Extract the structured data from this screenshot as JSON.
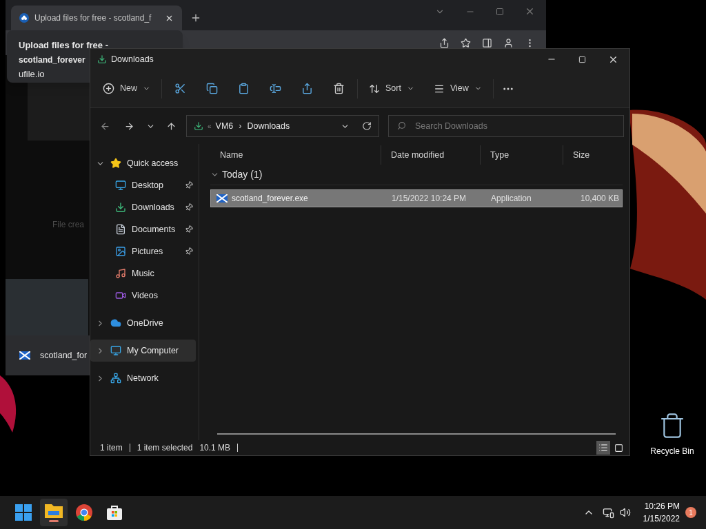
{
  "browser": {
    "tab": {
      "title": "Upload files for free - scotland_f",
      "selected": true
    },
    "tooltip": {
      "title": "Upload files for free -",
      "subtitle": "scotland_forever",
      "url": "ufile.io"
    },
    "page_text": "File crea",
    "download_item": {
      "name": "scotland_for"
    }
  },
  "explorer": {
    "title": "Downloads",
    "toolbar": {
      "new": "New",
      "sort": "Sort",
      "view": "View"
    },
    "address": {
      "overflow": "«",
      "parts": [
        "VM6",
        "Downloads"
      ],
      "separator": "›"
    },
    "search": {
      "placeholder": "Search Downloads"
    },
    "sidebar": [
      {
        "label": "Quick access",
        "kind": "star",
        "expanded": true,
        "selected": false,
        "children": [
          {
            "label": "Desktop",
            "kind": "desktop",
            "pinned": true,
            "selected": false
          },
          {
            "label": "Downloads",
            "kind": "download",
            "pinned": true,
            "selected": false
          },
          {
            "label": "Documents",
            "kind": "document",
            "pinned": true,
            "selected": false
          },
          {
            "label": "Pictures",
            "kind": "picture",
            "pinned": true,
            "selected": false
          },
          {
            "label": "Music",
            "kind": "music",
            "pinned": false,
            "selected": false
          },
          {
            "label": "Videos",
            "kind": "video",
            "pinned": false,
            "selected": false
          }
        ]
      },
      {
        "label": "OneDrive",
        "kind": "cloud",
        "expanded": false,
        "selected": false
      },
      {
        "label": "My Computer",
        "kind": "computer",
        "expanded": false,
        "selected": true
      },
      {
        "label": "Network",
        "kind": "network",
        "expanded": false,
        "selected": false
      }
    ],
    "columns": [
      "Name",
      "Date modified",
      "Type",
      "Size"
    ],
    "groups": [
      {
        "label": "Today (1)",
        "expanded": true,
        "rows": [
          {
            "name": "scotland_forever.exe",
            "date": "1/15/2022 10:24 PM",
            "type": "Application",
            "size": "10,400 KB",
            "selected": true
          }
        ]
      }
    ],
    "status": {
      "count": "1 item",
      "selection": "1 item selected",
      "size": "10.1 MB"
    },
    "view_modes": [
      {
        "kind": "details",
        "selected": true
      },
      {
        "kind": "tiles",
        "selected": false
      }
    ]
  },
  "desktop": {
    "icons": [
      {
        "label": "Recycle Bin"
      }
    ]
  },
  "taskbar": {
    "apps": [
      {
        "kind": "start",
        "active": false
      },
      {
        "kind": "explorer",
        "active": true
      },
      {
        "kind": "chrome",
        "active": false
      },
      {
        "kind": "store",
        "active": false
      }
    ],
    "time": "10:26 PM",
    "date": "1/15/2022",
    "notification_count": "1"
  }
}
